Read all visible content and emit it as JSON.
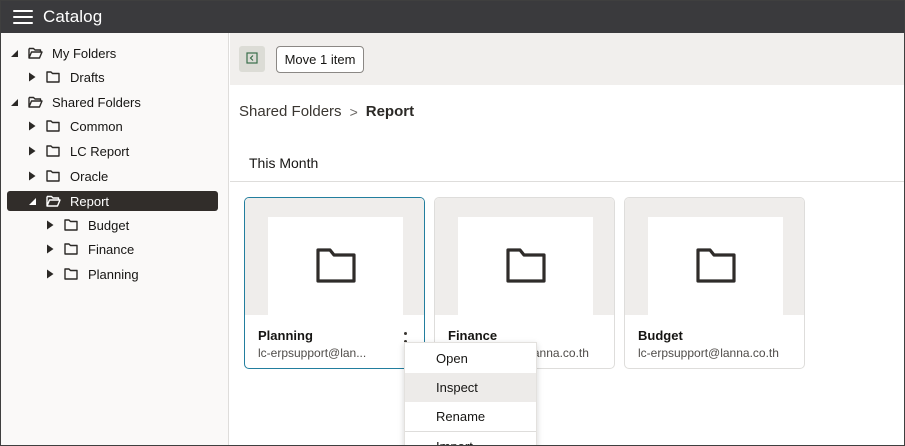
{
  "header": {
    "title": "Catalog",
    "menu_icon": "hamburger-menu-icon"
  },
  "sidebar": {
    "tree": [
      {
        "label": "My Folders",
        "expanded": true,
        "level": 0,
        "icon": "open-folder-icon"
      },
      {
        "label": "Drafts",
        "expanded": false,
        "level": 1,
        "icon": "folder-icon"
      },
      {
        "label": "Shared Folders",
        "expanded": true,
        "level": 0,
        "icon": "open-folder-icon"
      },
      {
        "label": "Common",
        "expanded": false,
        "level": 1,
        "icon": "folder-icon"
      },
      {
        "label": "LC Report",
        "expanded": false,
        "level": 1,
        "icon": "folder-icon"
      },
      {
        "label": "Oracle",
        "expanded": false,
        "level": 1,
        "icon": "folder-icon"
      },
      {
        "label": "Report",
        "expanded": true,
        "level": 1,
        "icon": "open-folder-icon",
        "selected": true
      },
      {
        "label": "Budget",
        "expanded": false,
        "level": 2,
        "icon": "folder-icon"
      },
      {
        "label": "Finance",
        "expanded": false,
        "level": 2,
        "icon": "folder-icon"
      },
      {
        "label": "Planning",
        "expanded": false,
        "level": 2,
        "icon": "folder-icon"
      }
    ]
  },
  "toolbar": {
    "collapse_icon": "collapse-panel-icon",
    "move_label": "Move 1 item"
  },
  "breadcrumb": {
    "parent": "Shared Folders",
    "separator": ">",
    "current": "Report"
  },
  "section": {
    "title": "This Month"
  },
  "cards": [
    {
      "name": "Planning",
      "owner": "lc-erpsupport@lan...",
      "icon": "folder-icon",
      "focused": true
    },
    {
      "name": "Finance",
      "owner": "lc-erpsupport@lanna.co.th",
      "icon": "folder-icon",
      "focused": false
    },
    {
      "name": "Budget",
      "owner": "lc-erpsupport@lanna.co.th",
      "icon": "folder-icon",
      "focused": false
    }
  ],
  "context_menu": {
    "items": [
      {
        "label": "Open"
      },
      {
        "label": "Inspect",
        "hovered": true
      },
      {
        "label": "Rename"
      },
      {
        "label": "Import"
      }
    ]
  },
  "colors": {
    "header_bg": "#3a3a3d",
    "selected_bg": "#312d2a",
    "focus_border": "#227e9e",
    "toolbar_bg": "#f1efed"
  }
}
